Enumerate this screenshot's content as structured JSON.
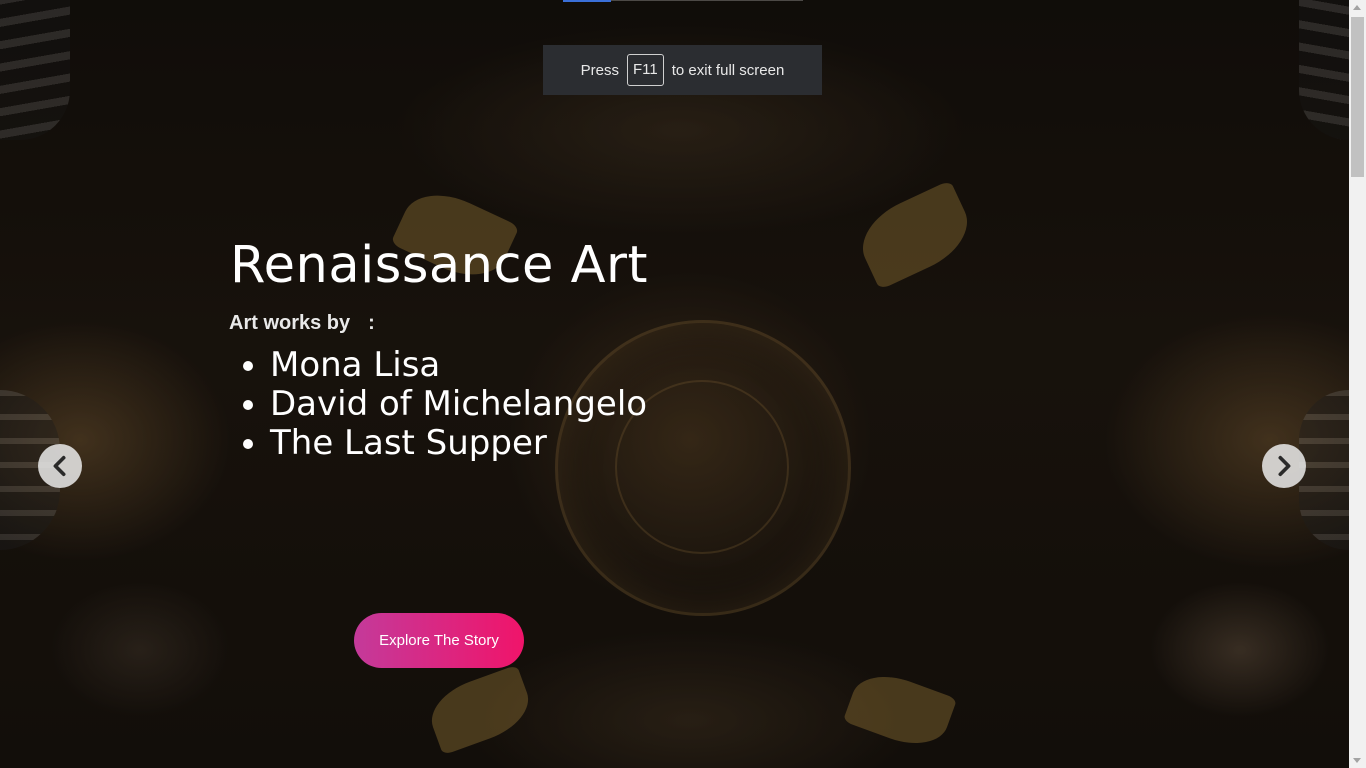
{
  "fullscreen_notice": {
    "before_key": "Press",
    "key": "F11",
    "after_key": "to exit full screen"
  },
  "hero": {
    "title": "Renaissance Art",
    "subtitle": "Art works by",
    "subtitle_suffix": ":",
    "works": [
      "Mona Lisa",
      "David of Michelangelo",
      "The Last Supper"
    ]
  },
  "cta": {
    "label": "Explore The Story"
  },
  "navigation": {
    "prev_icon": "chevron-left-icon",
    "next_icon": "chevron-right-icon"
  },
  "colors": {
    "cta_start": "#c43a9a",
    "cta_end": "#f0146a",
    "notice_bg": "#2b2d31"
  }
}
